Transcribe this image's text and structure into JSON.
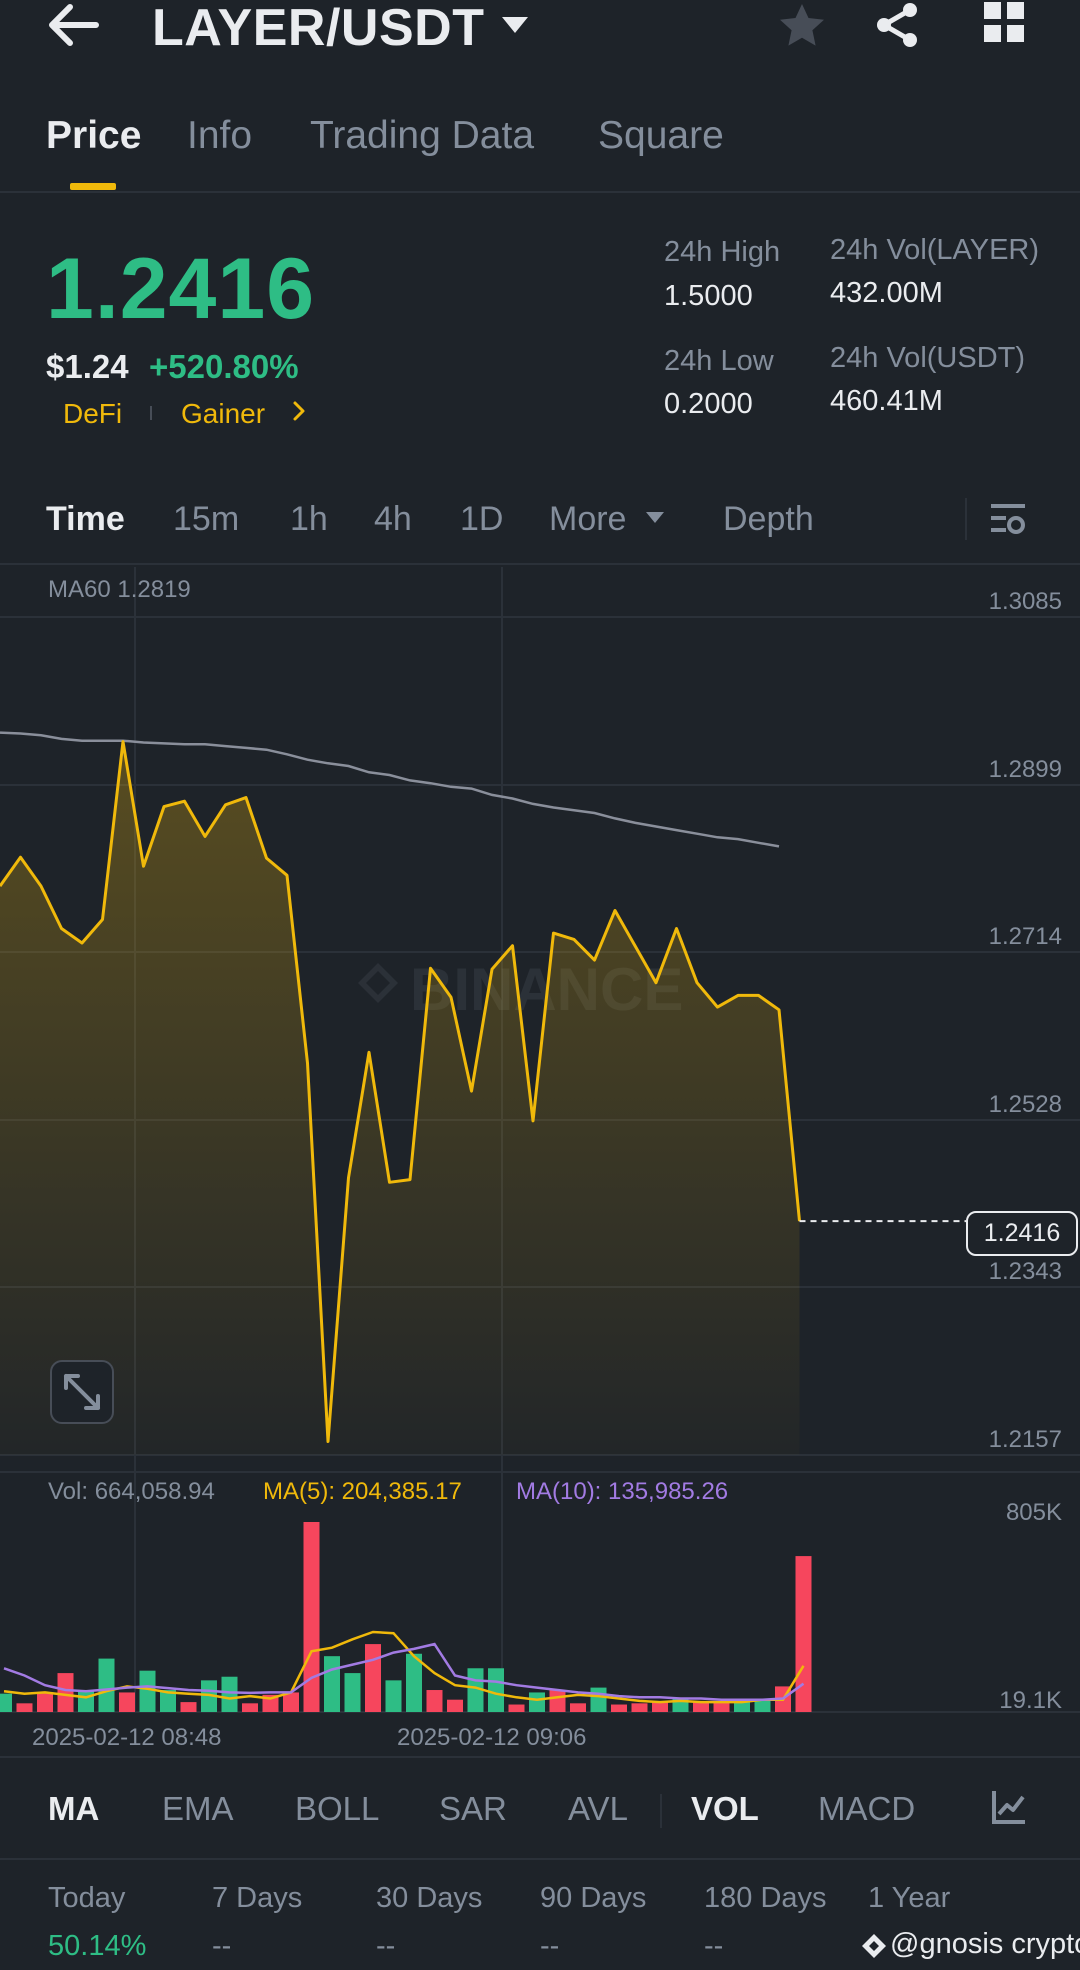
{
  "header": {
    "title": "LAYER/USDT",
    "icons": [
      "back-arrow-icon",
      "dropdown-caret-icon",
      "star-icon",
      "share-icon",
      "grid-icon"
    ]
  },
  "tabs": [
    {
      "label": "Price",
      "active": true
    },
    {
      "label": "Info",
      "active": false
    },
    {
      "label": "Trading Data",
      "active": false
    },
    {
      "label": "Square",
      "active": false
    }
  ],
  "price": {
    "last": "1.2416",
    "usd": "$1.24",
    "change_pct": "+520.80%",
    "tag1": "DeFi",
    "tag2": "Gainer"
  },
  "stats": {
    "high_label": "24h High",
    "high_value": "1.5000",
    "low_label": "24h Low",
    "low_value": "0.2000",
    "vol_base_label": "24h Vol(LAYER)",
    "vol_base_value": "432.00M",
    "vol_quote_label": "24h Vol(USDT)",
    "vol_quote_value": "460.41M"
  },
  "intervals": [
    {
      "label": "Time",
      "active": true
    },
    {
      "label": "15m",
      "active": false
    },
    {
      "label": "1h",
      "active": false
    },
    {
      "label": "4h",
      "active": false
    },
    {
      "label": "1D",
      "active": false
    },
    {
      "label": "More",
      "active": false
    },
    {
      "label": "Depth",
      "active": false
    }
  ],
  "colors": {
    "accent": "#f0b90b",
    "up": "#2ebd85",
    "down": "#f6465d",
    "ma10": "#a27be3",
    "background": "#1e2329"
  },
  "chart_data": {
    "type": "line",
    "ma60_label": "MA60 1.2819",
    "price_ticks": [
      "1.3085",
      "1.2899",
      "1.2714",
      "1.2528",
      "1.2343",
      "1.2157"
    ],
    "y_ticks": [
      1.3085,
      1.2899,
      1.2714,
      1.2528,
      1.2343,
      1.2157
    ],
    "ylim": [
      1.2157,
      1.3085
    ],
    "current_price": "1.2416",
    "current_price_value": 1.2416,
    "watermark": "BINANCE",
    "x_count": 41,
    "price": [
      1.2787,
      1.2819,
      1.2787,
      1.274,
      1.2724,
      1.275,
      1.2947,
      1.2809,
      1.2875,
      1.2881,
      1.2842,
      1.2877,
      1.2885,
      1.2818,
      1.2799,
      1.2591,
      1.2172,
      1.2464,
      1.2603,
      1.2459,
      1.2462,
      1.2696,
      1.2664,
      1.256,
      1.2695,
      1.2721,
      1.2527,
      1.2735,
      1.2728,
      1.2705,
      1.276,
      1.272,
      1.268,
      1.274,
      1.268,
      1.2653,
      1.2666,
      1.2666,
      1.265,
      1.2416
    ],
    "ma60": [
      1.2957,
      1.2956,
      1.2954,
      1.295,
      1.2948,
      1.2948,
      1.2948,
      1.2946,
      1.2945,
      1.2944,
      1.2944,
      1.2942,
      1.294,
      1.2938,
      1.2933,
      1.2927,
      1.2923,
      1.292,
      1.2913,
      1.291,
      1.2904,
      1.2901,
      1.2897,
      1.2895,
      1.2888,
      1.2884,
      1.2878,
      1.2874,
      1.2871,
      1.2868,
      1.2862,
      1.2857,
      1.2853,
      1.2849,
      1.2845,
      1.2841,
      1.2839,
      1.2835,
      1.2831
    ],
    "volume_legend": {
      "vol": "Vol: 664,058.94",
      "ma5": "MA(5): 204,385.17",
      "ma10": "MA(10): 135,985.26"
    },
    "volume_ticks": [
      "805K",
      "19.1K"
    ],
    "volume_ylim": [
      19100,
      805000
    ],
    "volume": [
      {
        "v": 95000,
        "up": true
      },
      {
        "v": 55000,
        "up": false
      },
      {
        "v": 100000,
        "up": false
      },
      {
        "v": 180000,
        "up": false
      },
      {
        "v": 110000,
        "up": true
      },
      {
        "v": 240000,
        "up": true
      },
      {
        "v": 100000,
        "up": false
      },
      {
        "v": 190000,
        "up": true
      },
      {
        "v": 110000,
        "up": true
      },
      {
        "v": 60000,
        "up": false
      },
      {
        "v": 150000,
        "up": true
      },
      {
        "v": 165000,
        "up": true
      },
      {
        "v": 55000,
        "up": false
      },
      {
        "v": 90000,
        "up": false
      },
      {
        "v": 100000,
        "up": false
      },
      {
        "v": 805000,
        "up": false
      },
      {
        "v": 250000,
        "up": true
      },
      {
        "v": 180000,
        "up": true
      },
      {
        "v": 300000,
        "up": false
      },
      {
        "v": 150000,
        "up": true
      },
      {
        "v": 260000,
        "up": true
      },
      {
        "v": 110000,
        "up": false
      },
      {
        "v": 70000,
        "up": false
      },
      {
        "v": 200000,
        "up": true
      },
      {
        "v": 200000,
        "up": true
      },
      {
        "v": 50000,
        "up": false
      },
      {
        "v": 100000,
        "up": true
      },
      {
        "v": 110000,
        "up": false
      },
      {
        "v": 55000,
        "up": false
      },
      {
        "v": 120000,
        "up": true
      },
      {
        "v": 50000,
        "up": false
      },
      {
        "v": 55000,
        "up": false
      },
      {
        "v": 60000,
        "up": false
      },
      {
        "v": 75000,
        "up": true
      },
      {
        "v": 60000,
        "up": false
      },
      {
        "v": 60000,
        "up": false
      },
      {
        "v": 60000,
        "up": true
      },
      {
        "v": 70000,
        "up": true
      },
      {
        "v": 125000,
        "up": false
      },
      {
        "v": 664000,
        "up": false
      }
    ],
    "vol_ma5": [
      105000,
      95000,
      100000,
      90000,
      80000,
      105000,
      125000,
      115000,
      100000,
      95000,
      90000,
      75000,
      85000,
      75000,
      100000,
      270000,
      285000,
      320000,
      350000,
      345000,
      250000,
      180000,
      130000,
      120000,
      95000,
      80000,
      70000,
      80000,
      90000,
      85000,
      75000,
      65000,
      60000,
      65000,
      60000,
      60000,
      60000,
      70000,
      70000,
      210000
    ],
    "vol_ma10": [
      200000,
      170000,
      130000,
      110000,
      105000,
      112000,
      120000,
      125000,
      118000,
      110000,
      107000,
      100000,
      98000,
      100000,
      100000,
      160000,
      195000,
      215000,
      235000,
      265000,
      280000,
      300000,
      170000,
      150000,
      145000,
      130000,
      120000,
      110000,
      100000,
      95000,
      85000,
      80000,
      80000,
      75000,
      75000,
      70000,
      70000,
      70000,
      75000,
      136000
    ],
    "x_labels": [
      "2025-02-12 08:48",
      "2025-02-12 09:06"
    ]
  },
  "indicators": [
    {
      "label": "MA",
      "active": true
    },
    {
      "label": "EMA",
      "active": false
    },
    {
      "label": "BOLL",
      "active": false
    },
    {
      "label": "SAR",
      "active": false
    },
    {
      "label": "AVL",
      "active": false
    },
    {
      "label": "VOL",
      "active": true
    },
    {
      "label": "MACD",
      "active": false
    }
  ],
  "performance": [
    {
      "label": "Today",
      "value": "50.14%"
    },
    {
      "label": "7 Days",
      "value": "--"
    },
    {
      "label": "30 Days",
      "value": "--"
    },
    {
      "label": "90 Days",
      "value": "--"
    },
    {
      "label": "180 Days",
      "value": "--"
    },
    {
      "label": "1 Year",
      "value": ""
    }
  ],
  "watermark_credit": "@gnosis crypto"
}
